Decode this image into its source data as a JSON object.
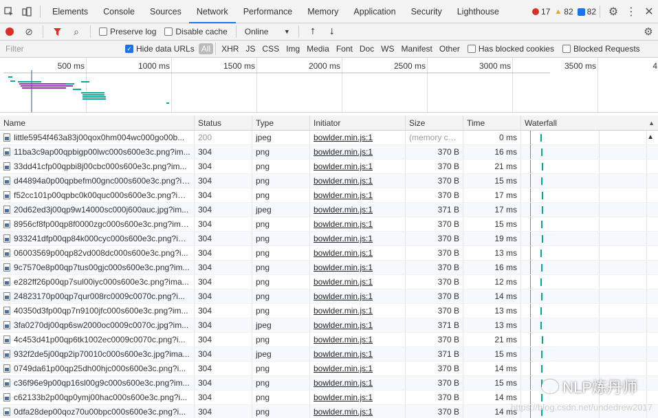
{
  "tabbar": {
    "tabs": [
      "Elements",
      "Console",
      "Sources",
      "Network",
      "Performance",
      "Memory",
      "Application",
      "Security",
      "Lighthouse"
    ],
    "active_tab": "Network",
    "errors": "17",
    "warnings": "82",
    "info": "82"
  },
  "toolbar": {
    "preserve_log": "Preserve log",
    "disable_cache": "Disable cache",
    "throttle": "Online"
  },
  "filterbar": {
    "placeholder": "Filter",
    "hide_data_urls": "Hide data URLs",
    "types": [
      "All",
      "XHR",
      "JS",
      "CSS",
      "Img",
      "Media",
      "Font",
      "Doc",
      "WS",
      "Manifest",
      "Other"
    ],
    "has_blocked_cookies": "Has blocked cookies",
    "blocked_requests": "Blocked Requests"
  },
  "overview": {
    "ticks": [
      "500 ms",
      "1000 ms",
      "1500 ms",
      "2000 ms",
      "2500 ms",
      "3000 ms",
      "3500 ms",
      "4"
    ]
  },
  "table": {
    "headers": {
      "name": "Name",
      "status": "Status",
      "type": "Type",
      "initiator": "Initiator",
      "size": "Size",
      "time": "Time",
      "waterfall": "Waterfall"
    },
    "rows": [
      {
        "name": "little5954f463a83j00qox0hm004wc000go00b...",
        "status": "200",
        "type": "jpeg",
        "initiator": "bowlder.min.js:1",
        "size": "(memory ca...",
        "time": "0 ms"
      },
      {
        "name": "11ba3c9ap00qpbigp00lwc000s600e3c.png?im...",
        "status": "304",
        "type": "png",
        "initiator": "bowlder.min.js:1",
        "size": "370 B",
        "time": "16 ms"
      },
      {
        "name": "33dd41cfp00qpbi8j00cbc000s600e3c.png?im...",
        "status": "304",
        "type": "png",
        "initiator": "bowlder.min.js:1",
        "size": "370 B",
        "time": "21 ms"
      },
      {
        "name": "d44894a0p00qpbefm00gnc000s600e3c.png?im...",
        "status": "304",
        "type": "png",
        "initiator": "bowlder.min.js:1",
        "size": "370 B",
        "time": "15 ms"
      },
      {
        "name": "f52cc101p00qpbc0k00quc000s600e3c.png?im...",
        "status": "304",
        "type": "png",
        "initiator": "bowlder.min.js:1",
        "size": "370 B",
        "time": "17 ms"
      },
      {
        "name": "20d62ed3j00qp9w14000sc000j600auc.jpg?im...",
        "status": "304",
        "type": "jpeg",
        "initiator": "bowlder.min.js:1",
        "size": "371 B",
        "time": "17 ms"
      },
      {
        "name": "8956cf8fp00qp8f0000zgc000s600e3c.png?ima...",
        "status": "304",
        "type": "png",
        "initiator": "bowlder.min.js:1",
        "size": "370 B",
        "time": "15 ms"
      },
      {
        "name": "933241dfp00qp84k000cyc000s600e3c.png?im...",
        "status": "304",
        "type": "png",
        "initiator": "bowlder.min.js:1",
        "size": "370 B",
        "time": "19 ms"
      },
      {
        "name": "06003569p00qp82vd008dc000s600e3c.png?i...",
        "status": "304",
        "type": "png",
        "initiator": "bowlder.min.js:1",
        "size": "370 B",
        "time": "13 ms"
      },
      {
        "name": "9c7570e8p00qp7tus00gjc000s600e3c.png?im...",
        "status": "304",
        "type": "png",
        "initiator": "bowlder.min.js:1",
        "size": "370 B",
        "time": "16 ms"
      },
      {
        "name": "e282ff26p00qp7sul00iyc000s600e3c.png?ima...",
        "status": "304",
        "type": "png",
        "initiator": "bowlder.min.js:1",
        "size": "370 B",
        "time": "12 ms"
      },
      {
        "name": "24823170p00qp7qur008rc0009c0070c.png?i...",
        "status": "304",
        "type": "png",
        "initiator": "bowlder.min.js:1",
        "size": "370 B",
        "time": "14 ms"
      },
      {
        "name": "40350d3fp00qp7n9100jfc000s600e3c.png?im...",
        "status": "304",
        "type": "png",
        "initiator": "bowlder.min.js:1",
        "size": "370 B",
        "time": "13 ms"
      },
      {
        "name": "3fa0270dj00qp6sw2000oc0009c0070c.jpg?im...",
        "status": "304",
        "type": "jpeg",
        "initiator": "bowlder.min.js:1",
        "size": "371 B",
        "time": "13 ms"
      },
      {
        "name": "4c453d41p00qp6tk1002ec0009c0070c.png?i...",
        "status": "304",
        "type": "png",
        "initiator": "bowlder.min.js:1",
        "size": "370 B",
        "time": "21 ms"
      },
      {
        "name": "932f2de5j00qp2ip70010c000s600e3c.jpg?ima...",
        "status": "304",
        "type": "jpeg",
        "initiator": "bowlder.min.js:1",
        "size": "371 B",
        "time": "15 ms"
      },
      {
        "name": "0749da61p00qp25dh00hjc000s600e3c.png?i...",
        "status": "304",
        "type": "png",
        "initiator": "bowlder.min.js:1",
        "size": "370 B",
        "time": "14 ms"
      },
      {
        "name": "c36f96e9p00qp16sl00g9c000s600e3c.png?im...",
        "status": "304",
        "type": "png",
        "initiator": "bowlder.min.js:1",
        "size": "370 B",
        "time": "15 ms"
      },
      {
        "name": "c62133b2p00qp0ymj00hac000s600e3c.png?i...",
        "status": "304",
        "type": "png",
        "initiator": "bowlder.min.js:1",
        "size": "370 B",
        "time": "14 ms"
      },
      {
        "name": "0dfa28dep00qoz70u00bpc000s600e3c.png?i...",
        "status": "304",
        "type": "png",
        "initiator": "bowlder.min.js:1",
        "size": "370 B",
        "time": "14 ms"
      }
    ]
  },
  "watermark": {
    "brand": "NLP炼丹师",
    "url": "https://blog.csdn.net/undedrew2017"
  }
}
